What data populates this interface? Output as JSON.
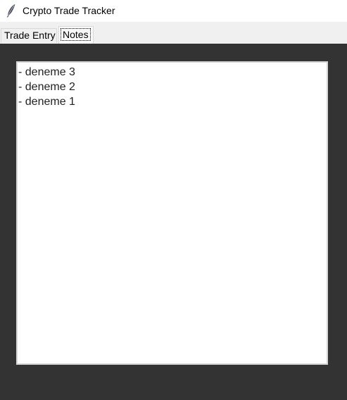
{
  "window": {
    "title": "Crypto Trade Tracker",
    "icon": "feather-icon"
  },
  "tabs": [
    {
      "label": "Trade Entry",
      "selected": false
    },
    {
      "label": "Notes",
      "selected": true
    }
  ],
  "notes": {
    "lines": [
      "- deneme 3",
      "- deneme 2",
      "- deneme 1"
    ]
  },
  "colors": {
    "content_background": "#333333",
    "text_area_background": "#ffffff",
    "tab_strip_background": "#f0f0f0"
  }
}
